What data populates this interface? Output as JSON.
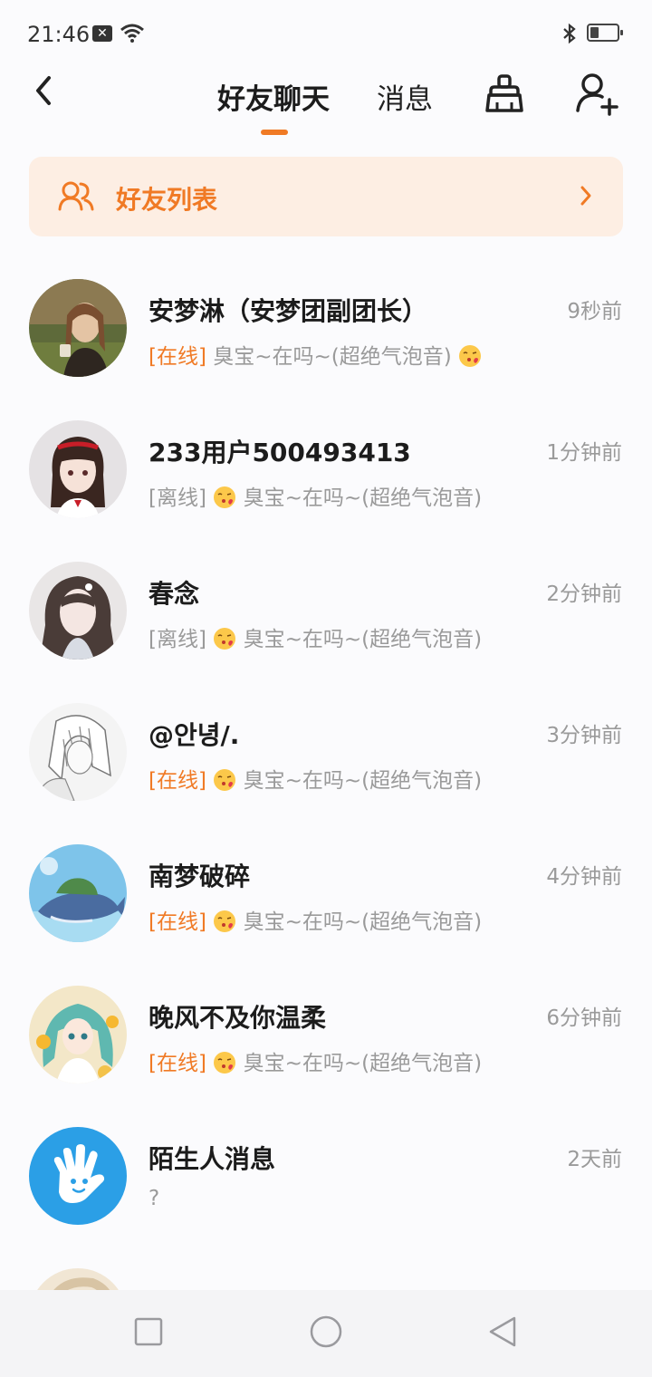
{
  "status_bar": {
    "time": "21:46",
    "icons": [
      "notification-x-icon",
      "wifi-icon",
      "bluetooth-icon",
      "battery-icon"
    ],
    "battery_level": 0.3
  },
  "header": {
    "tabs": [
      {
        "label": "好友聊天",
        "active": true
      },
      {
        "label": "消息",
        "active": false
      }
    ],
    "accent_color": "#f07a25"
  },
  "banner": {
    "label": "好友列表",
    "background": "#fdeee3"
  },
  "chats": [
    {
      "name": "安梦淋（安梦团副团长）",
      "time": "9秒前",
      "status": "[在线]",
      "online": true,
      "message": "臭宝~在吗~(超绝气泡音)",
      "emoji_after": true
    },
    {
      "name": "233用户500493413",
      "time": "1分钟前",
      "status": "[离线]",
      "online": false,
      "message": "臭宝~在吗~(超绝气泡音)"
    },
    {
      "name": "春念",
      "time": "2分钟前",
      "status": "[离线]",
      "online": false,
      "message": "臭宝~在吗~(超绝气泡音)"
    },
    {
      "name": "@안녕/.",
      "time": "3分钟前",
      "status": "[在线]",
      "online": true,
      "message": "臭宝~在吗~(超绝气泡音)"
    },
    {
      "name": "南梦破碎",
      "time": "4分钟前",
      "status": "[在线]",
      "online": true,
      "message": "臭宝~在吗~(超绝气泡音)"
    },
    {
      "name": "晚风不及你温柔",
      "time": "6分钟前",
      "status": "[在线]",
      "online": true,
      "message": "臭宝~在吗~(超绝气泡音)"
    },
    {
      "name": "陌生人消息",
      "time": "2天前",
      "status": "",
      "online": false,
      "message": "?"
    }
  ],
  "nav_bar": {
    "buttons": [
      "recent-apps-icon",
      "home-icon",
      "back-icon"
    ]
  }
}
